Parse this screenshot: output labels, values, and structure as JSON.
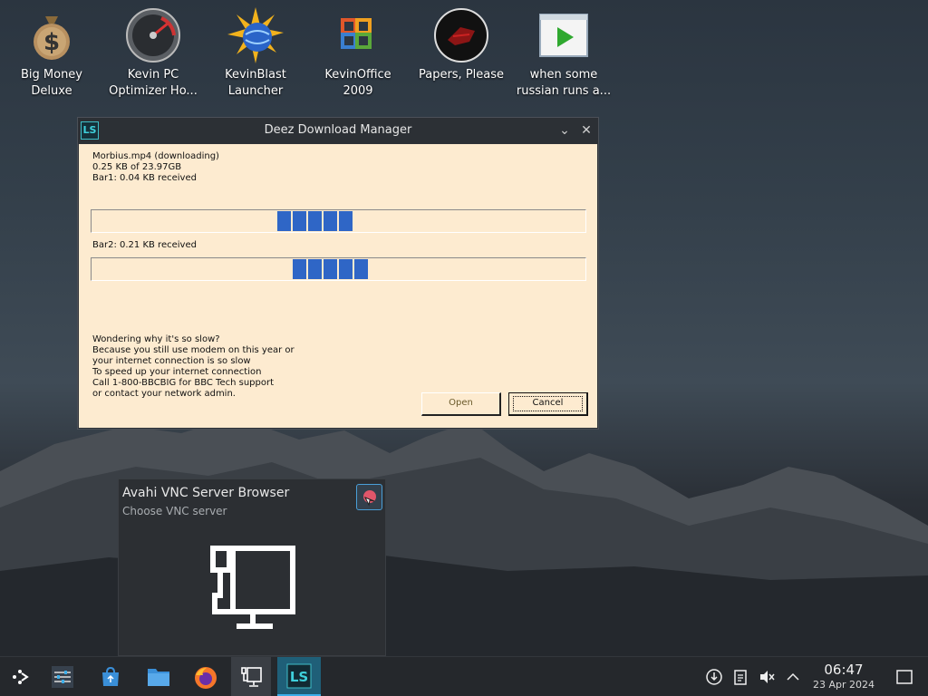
{
  "desktop": {
    "icons": [
      {
        "label": "Big Money\nDeluxe",
        "line1": "Big Money",
        "line2": "Deluxe",
        "icon": "money-bag-icon"
      },
      {
        "label": "Kevin PC Optimizer Ho...",
        "line1": "Kevin PC",
        "line2": "Optimizer Ho...",
        "icon": "speedometer-icon"
      },
      {
        "label": "KevinBlast Launcher",
        "line1": "KevinBlast",
        "line2": "Launcher",
        "icon": "sun-globe-icon"
      },
      {
        "label": "KevinOffice 2009",
        "line1": "KevinOffice",
        "line2": "2009",
        "icon": "office-logo-icon"
      },
      {
        "label": "Papers, Please",
        "line1": "Papers, Please",
        "line2": "",
        "icon": "papers-please-icon"
      },
      {
        "label": "when some russian runs a...",
        "line1": "when some",
        "line2": "russian runs a...",
        "icon": "video-play-icon"
      }
    ]
  },
  "download_window": {
    "title": "Deez Download Manager",
    "app_icon_text": "LS",
    "file_line": "Morbius.mp4 (downloading)",
    "size_line": "0.25 KB of 23.97GB",
    "bar1_label": "Bar1: 0.04 KB received",
    "bar2_label": "Bar2: 0.21 KB received",
    "bar1_blocks": 5,
    "bar2_blocks": 5,
    "message_lines": [
      "Wondering why it's so slow?",
      "Because you still use modem on this year or",
      "your internet connection is so slow",
      "To speed up your internet connection",
      "Call 1-800-BBCBIG for BBC Tech support",
      "or contact your network admin."
    ],
    "open_label": "Open",
    "cancel_label": "Cancel"
  },
  "preview": {
    "title": "Avahi VNC Server Browser",
    "subtitle": "Choose VNC server"
  },
  "taskbar": {
    "items": [
      "app-launcher-icon",
      "system-settings-icon",
      "store-icon",
      "file-manager-icon",
      "firefox-icon",
      "vnc-browser-icon",
      "ls-app-icon"
    ],
    "ls_text": "LS",
    "tray": [
      "network-icon",
      "clipboard-icon",
      "volume-muted-icon",
      "tray-expand-icon"
    ],
    "time": "06:47",
    "date": "23 Apr 2024"
  },
  "colors": {
    "window_body": "#fdebd0",
    "progress_block": "#2f66c6",
    "taskbar": "#25282c",
    "accent": "#3daee9"
  }
}
